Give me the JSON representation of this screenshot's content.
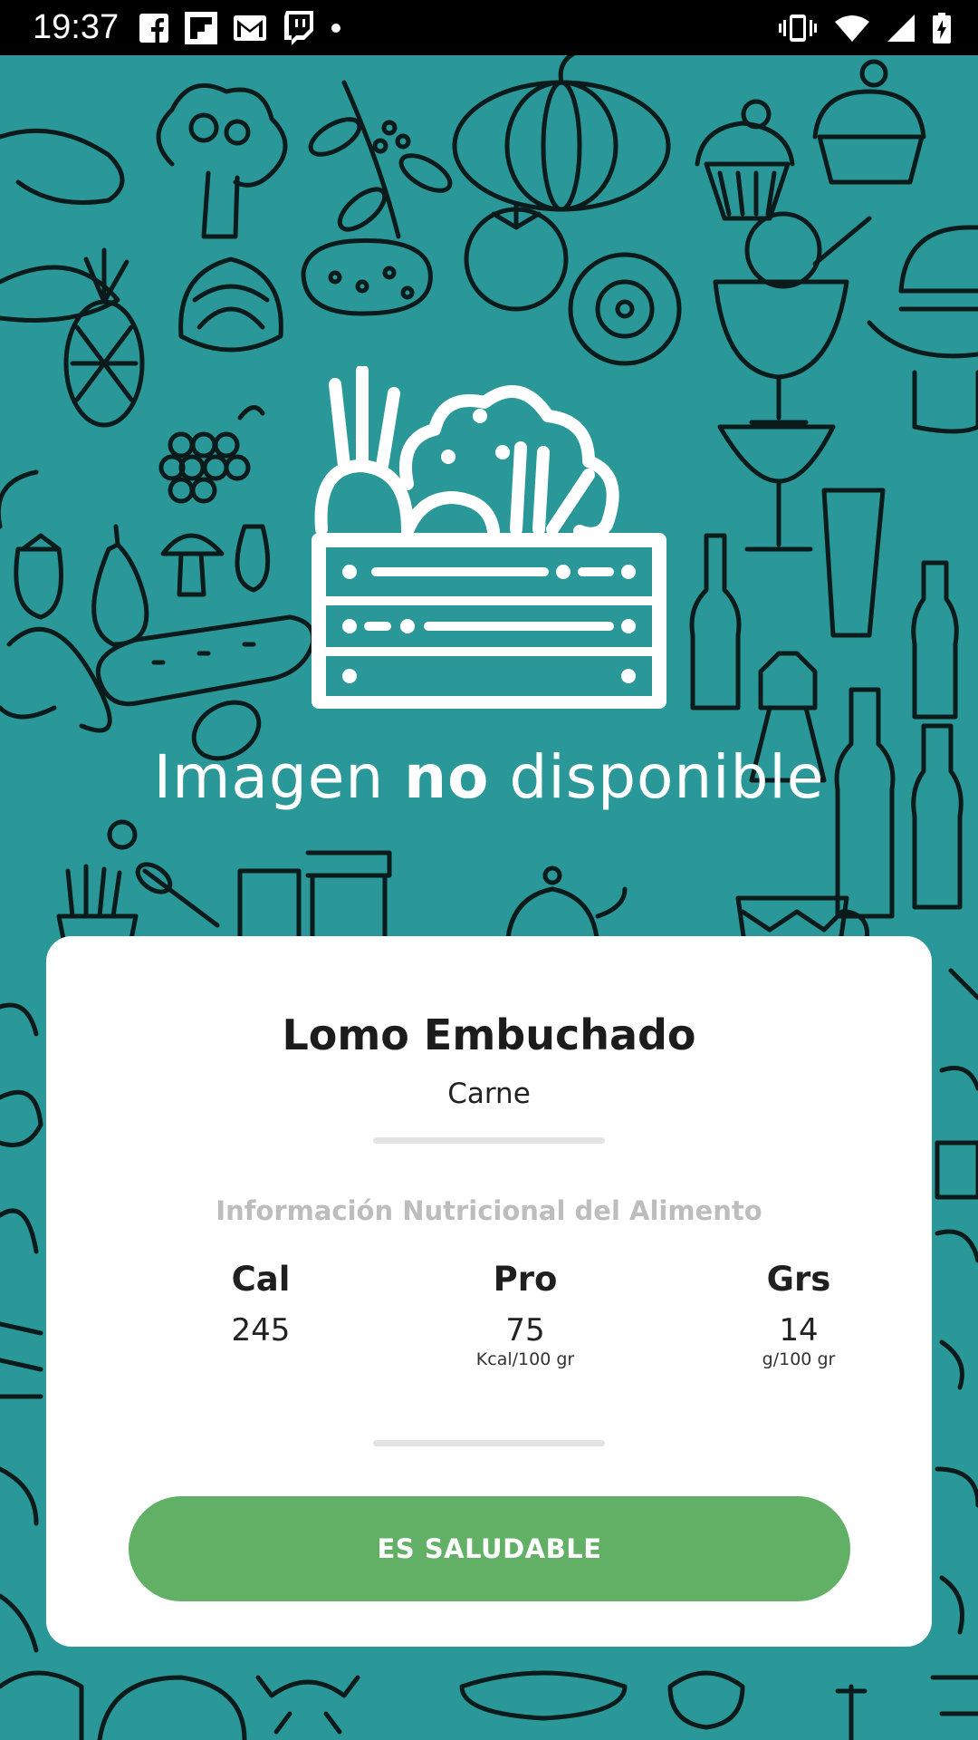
{
  "status_bar": {
    "time": "19:37",
    "left_icons": [
      "facebook-icon",
      "flipboard-icon",
      "gmail-icon",
      "twitch-icon",
      "notification-dot-icon"
    ],
    "right_icons": [
      "vibrate-icon",
      "wifi-icon",
      "signal-icon",
      "battery-icon"
    ]
  },
  "hero": {
    "no_image_prefix": "Imagen ",
    "no_image_bold": "no",
    "no_image_suffix": " disponible",
    "logo_icon": "vegetable-crate-icon"
  },
  "card": {
    "food_name": "Lomo Embuchado",
    "category": "Carne",
    "nutrition_title": "Información Nutricional del Alimento",
    "columns": [
      {
        "label": "Cal",
        "value": "245",
        "unit": ""
      },
      {
        "label": "Pro",
        "value": "75",
        "unit": "Kcal/100 gr"
      },
      {
        "label": "Grs",
        "value": "14",
        "unit": "g/100 gr"
      }
    ],
    "healthy_button": "ES SALUDABLE"
  },
  "colors": {
    "background": "#2a9898",
    "button": "#62b065",
    "card": "#ffffff"
  }
}
